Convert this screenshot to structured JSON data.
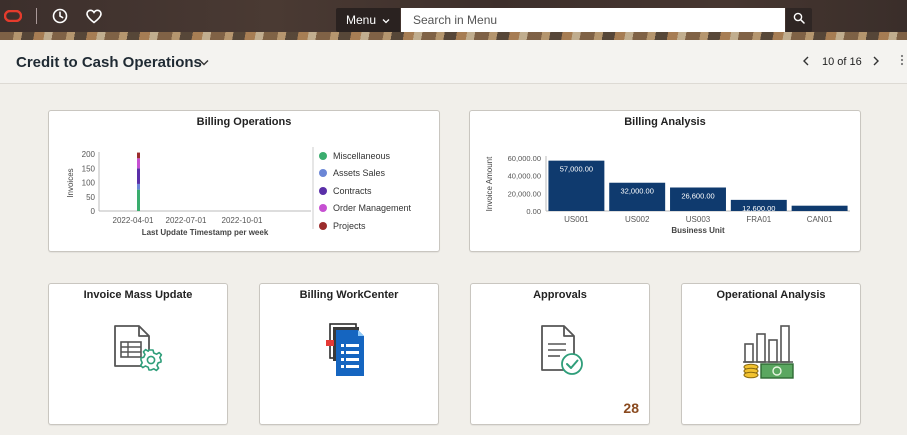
{
  "topbar": {
    "menu_label": "Menu",
    "search_placeholder": "Search in Menu"
  },
  "header": {
    "title": "Credit to Cash Operations",
    "pager": "10 of 16"
  },
  "tiles": {
    "billing_operations": {
      "title": "Billing Operations"
    },
    "billing_analysis": {
      "title": "Billing Analysis"
    },
    "invoice_mass_update": {
      "title": "Invoice Mass Update"
    },
    "billing_workcenter": {
      "title": "Billing WorkCenter"
    },
    "approvals": {
      "title": "Approvals",
      "count": "28"
    },
    "operational_analysis": {
      "title": "Operational Analysis"
    }
  },
  "colors": {
    "bar_navy": "#0f3a6e",
    "miscellaneous": "#3aad6e",
    "assets_sales": "#6b86d6",
    "contracts": "#5a2fa8",
    "order_management": "#c650d2",
    "projects": "#9b2c2c",
    "approvals_count": "#8a4a1f"
  },
  "chart_data": [
    {
      "type": "bar",
      "title": "Billing Operations",
      "xlabel": "Last Update Timestamp per week",
      "ylabel": "Invoices",
      "ylim": [
        0,
        200
      ],
      "yticks": [
        "200",
        "150",
        "100",
        "50",
        "0"
      ],
      "xticks": [
        "2022-04-01",
        "2022-07-01",
        "2022-10-01"
      ],
      "stacked": true,
      "categories": [
        "2022-04-01"
      ],
      "series": [
        {
          "name": "Miscellaneous",
          "values": [
            75
          ]
        },
        {
          "name": "Assets Sales",
          "values": [
            20
          ]
        },
        {
          "name": "Contracts",
          "values": [
            55
          ]
        },
        {
          "name": "Order Management",
          "values": [
            35
          ]
        },
        {
          "name": "Projects",
          "values": [
            20
          ]
        }
      ],
      "grid": false,
      "legend": "right"
    },
    {
      "type": "bar",
      "title": "Billing Analysis",
      "xlabel": "Business Unit",
      "ylabel": "Invoice Amount",
      "ylim": [
        0,
        60000
      ],
      "yticks": [
        "60,000.00",
        "40,000.00",
        "20,000.00",
        "0.00"
      ],
      "categories": [
        "US001",
        "US002",
        "US003",
        "FRA01",
        "CAN01"
      ],
      "values": [
        57000,
        32000,
        26600,
        12600,
        6000
      ],
      "data_labels": [
        "57,000.00",
        "32,000.00",
        "26,600.00",
        "12,600.00",
        ""
      ],
      "grid": false,
      "legend": "none"
    }
  ]
}
